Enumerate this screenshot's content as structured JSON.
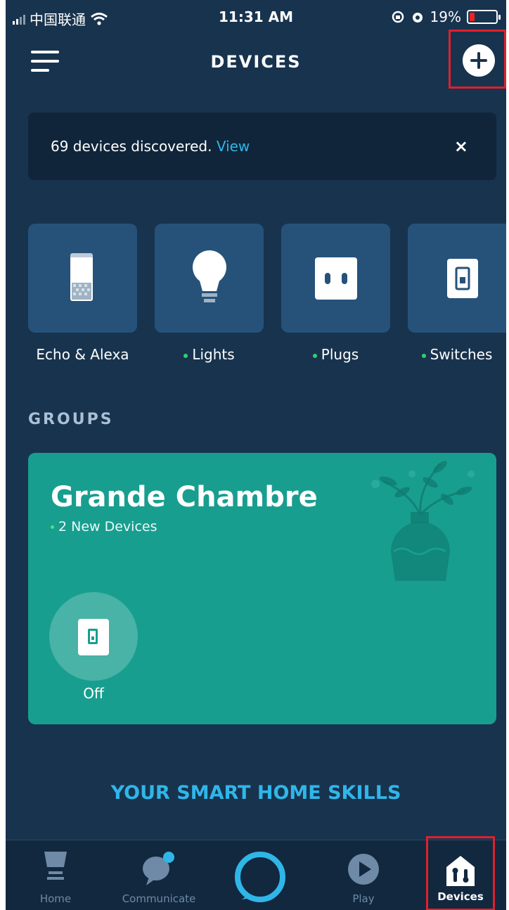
{
  "status_bar": {
    "carrier": "中国联通",
    "time": "11:31 AM",
    "battery": "19%",
    "battery_level": 0.19
  },
  "header": {
    "title": "DEVICES",
    "menu_icon": "hamburger-menu-icon",
    "add_icon": "plus-circle-icon"
  },
  "banner": {
    "message": "69 devices discovered.",
    "link": "View",
    "close": "×"
  },
  "categories": [
    {
      "label": "Echo & Alexa",
      "icon": "echo-speaker-icon",
      "new": false
    },
    {
      "label": "Lights",
      "icon": "light-bulb-icon",
      "new": true
    },
    {
      "label": "Plugs",
      "icon": "plug-icon",
      "new": true
    },
    {
      "label": "Switches",
      "icon": "switch-icon",
      "new": true
    }
  ],
  "groups": {
    "heading": "GROUPS",
    "card": {
      "name": "Grande Chambre",
      "subtitle": "2 New Devices",
      "device_state": "Off"
    }
  },
  "skills_link": "YOUR SMART HOME SKILLS",
  "tabs": [
    {
      "label": "Home",
      "icon": "home-icon"
    },
    {
      "label": "Communicate",
      "icon": "chat-bubble-icon"
    },
    {
      "label": "",
      "icon": "alexa-ring-icon"
    },
    {
      "label": "Play",
      "icon": "play-icon"
    },
    {
      "label": "Devices",
      "icon": "devices-house-icon"
    }
  ],
  "colors": {
    "background": "#18334e",
    "accent": "#2fb6e8",
    "card": "#189e8f",
    "highlight": "#e0202c",
    "new_dot": "#2ed36b"
  }
}
